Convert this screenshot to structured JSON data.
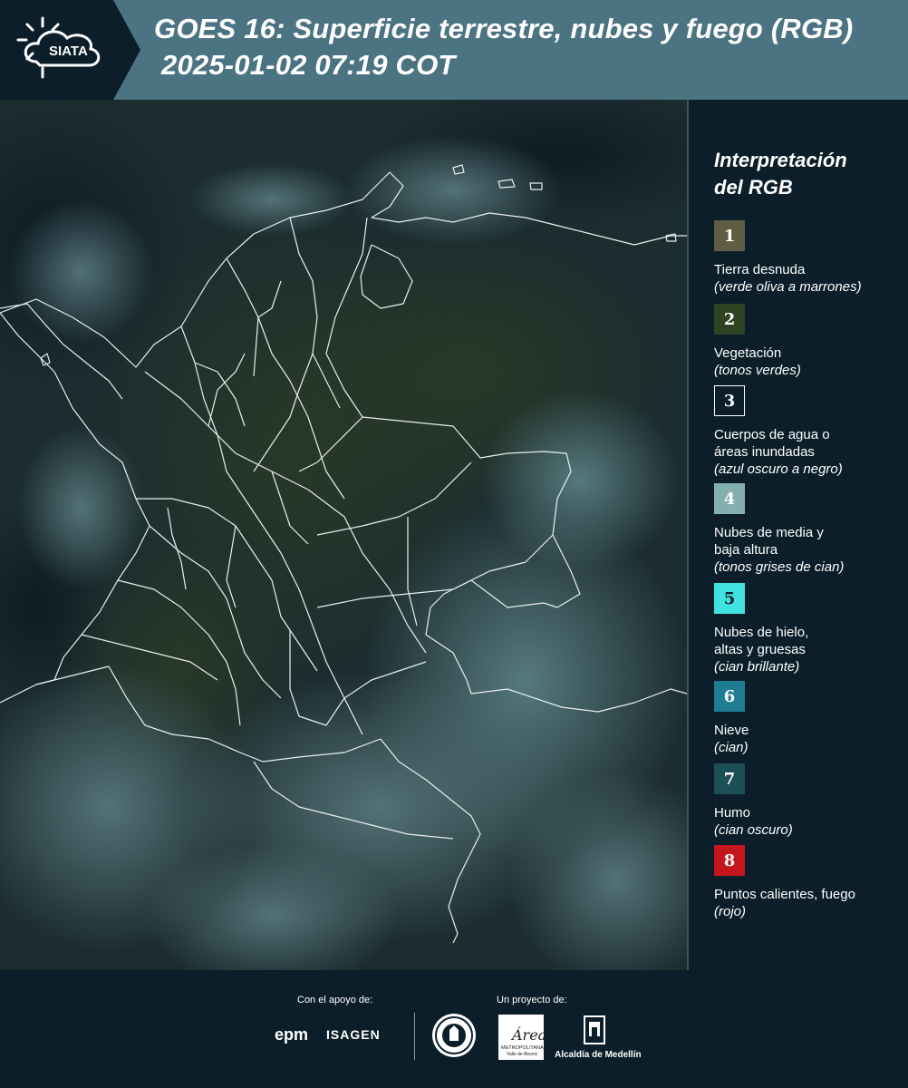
{
  "header": {
    "logo_text": "SIATA",
    "title_line1": "GOES 16: Superficie terrestre, nubes y fuego (RGB)",
    "title_line2": "2025-01-02 07:19 COT"
  },
  "legend": {
    "title_line1": "Interpretación",
    "title_line2": "del RGB",
    "items": [
      {
        "number": "1",
        "name": "Tierra desnuda",
        "desc": "(verde oliva a marrones)",
        "color": "#5e5e45"
      },
      {
        "number": "2",
        "name": "Vegetación",
        "desc": "(tonos verdes)",
        "color": "#2d4322"
      },
      {
        "number": "3",
        "name": "Cuerpos de agua o áreas inundadas",
        "desc": "(azul oscuro a negro)",
        "color": "#0b1e29"
      },
      {
        "number": "4",
        "name": "Nubes de media y baja altura",
        "desc": "(tonos grises de cian)",
        "color": "#84afaf"
      },
      {
        "number": "5",
        "name": "Nubes de hielo, altas y gruesas",
        "desc": "(cian brillante)",
        "color": "#3fe2e0"
      },
      {
        "number": "6",
        "name": "Nieve",
        "desc": "(cian)",
        "color": "#1f7d93"
      },
      {
        "number": "7",
        "name": "Humo",
        "desc": "(cian oscuro)",
        "color": "#1d4f56"
      },
      {
        "number": "8",
        "name": "Puntos calientes, fuego",
        "desc": "(rojo)",
        "color": "#c4161c"
      }
    ]
  },
  "footer": {
    "support_caption": "Con el apoyo de:",
    "project_caption": "Un proyecto de:",
    "sponsor_epm": "epm",
    "sponsor_isagen": "ISAGEN",
    "amva_name": "Área",
    "amva_sub": "METROPOLITANA",
    "amva_sub2": "Valle de Aburrá",
    "alcaldia": "Alcaldía de Medellín"
  },
  "colors": {
    "header_bg": "#4b7381",
    "logo_bg": "#0b1e29",
    "page_bg": "#0b1e29",
    "border_lines": "#e8eef0"
  }
}
